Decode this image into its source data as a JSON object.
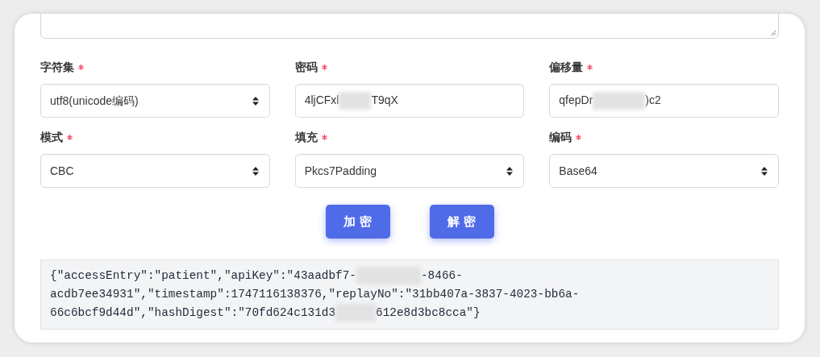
{
  "fields": [
    {
      "label": "字符集",
      "required": true,
      "kind": "select",
      "value_parts": [
        "utf8(unicode编码)"
      ]
    },
    {
      "label": "密码",
      "required": true,
      "kind": "input",
      "value_parts": [
        "4ljCFxl",
        "T9qX"
      ]
    },
    {
      "label": "偏移量",
      "required": true,
      "kind": "input",
      "value_parts": [
        "qfepDr",
        ")c2"
      ]
    },
    {
      "label": "模式",
      "required": true,
      "kind": "select",
      "value_parts": [
        "CBC"
      ]
    },
    {
      "label": "填充",
      "required": true,
      "kind": "select",
      "value_parts": [
        "Pkcs7Padding"
      ]
    },
    {
      "label": "编码",
      "required": true,
      "kind": "select",
      "value_parts": [
        "Base64"
      ]
    }
  ],
  "buttons": [
    "加 密",
    "解 密"
  ],
  "output": {
    "parts": [
      "{\"accessEntry\":\"patient\",\"apiKey\":\"43aadbf7-",
      "-8466-acdb7ee34931\",\"timestamp\":1747116138376,\"replayNo\":\"31bb407a-3837-4023-bb6a-66c6bcf9d44d\",\"hashDigest\":\"70fd624c131d3",
      "612e8d3bc8cca\"}"
    ]
  }
}
